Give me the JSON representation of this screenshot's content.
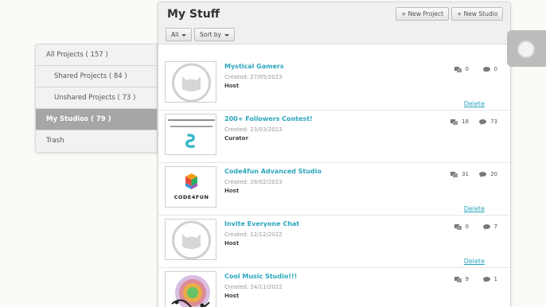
{
  "sidebar": {
    "items": [
      {
        "label": "All Projects ( 157 )"
      },
      {
        "label": "Shared Projects ( 84 )"
      },
      {
        "label": "Unshared Projects ( 73 )"
      },
      {
        "label": "My Studios ( 79 )"
      },
      {
        "label": "Trash"
      }
    ]
  },
  "header": {
    "title": "My Stuff",
    "new_project_label": "+ New Project",
    "new_studio_label": "+ New Studio",
    "filter_label": "All",
    "sort_label": "Sort by"
  },
  "studios": [
    {
      "title": "Mystical Gamers",
      "created": "Created: 27/05/2023",
      "role": "Host",
      "projects": "0",
      "comments": "0",
      "delete": "Delete",
      "thumb": "default-cat"
    },
    {
      "title": "200+ Followers Contest!",
      "created": "Created: 23/03/2023",
      "role": "Curator",
      "projects": "18",
      "comments": "73",
      "delete": "",
      "thumb": "contest-banner",
      "thumb_text_1": "PLINKER00 PUT 200 leaders 2 Follows",
      "thumb_text_2": "2 - 10 Followers Anything Contest"
    },
    {
      "title": "Code4fun Advanced Studio",
      "created": "Created: 28/02/2023",
      "role": "Host",
      "projects": "31",
      "comments": "20",
      "delete": "Delete",
      "thumb": "code4fun-logo",
      "thumb_text": "CODE4FUN"
    },
    {
      "title": "Invite Everyone Chat",
      "created": "Created: 12/12/2022",
      "role": "Host",
      "projects": "0",
      "comments": "7",
      "delete": "Delete",
      "thumb": "default-cat"
    },
    {
      "title": "Cool Music Studio!!!",
      "created": "Created: 24/11/2022",
      "role": "Host",
      "projects": "9",
      "comments": "1",
      "delete": "",
      "thumb": "music-art"
    }
  ],
  "colors": {
    "accent": "#2aa5bd",
    "sidebar_active": "#a6a6a6"
  }
}
